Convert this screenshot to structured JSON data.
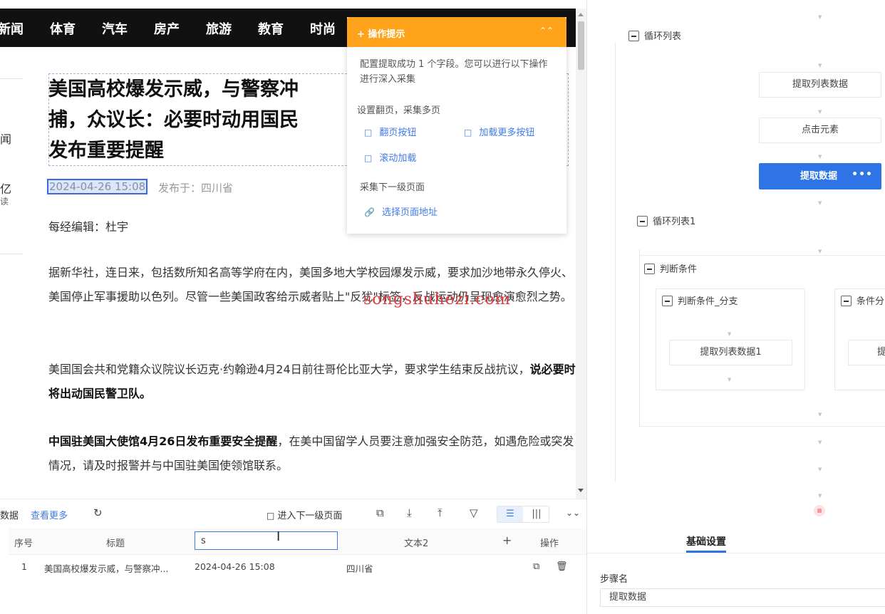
{
  "nav": {
    "items": [
      "新闻",
      "体育",
      "汽车",
      "房产",
      "旅游",
      "教育",
      "时尚"
    ]
  },
  "side_fragments": [
    "闻",
    "亿",
    "读"
  ],
  "article": {
    "title": "美国高校爆发示威，与警察冲突，逮捕，众议长：必要时动用国民警卫队 发布重要提醒",
    "title_lines": [
      "美国高校爆发示威，与警察冲",
      "捕，众议长：必要时动用国民",
      "发布重要提醒"
    ],
    "date": "2024-04-26 15:08",
    "published_from": "发布于：四川省",
    "editor": "每经编辑：杜宇",
    "para1": "据新华社，连日来，包括数所知名高等学府在内，美国多地大学校园爆发示威，要求加沙地带永久停火、美国停止军事援助以色列。尽管一些美国政客给示威者贴上\"反犹\"标签，反战运动仍呈现愈演愈烈之势。",
    "para2_normal": "美国国会共和党籍众议院议长迈克·约翰逊4月24日前往哥伦比亚大学，要求学生结束反战抗议，",
    "para2_bold": "说必要时将出动国民警卫队。",
    "para3_bold": "中国驻美国大使馆4月26日发布重要安全提醒",
    "para3_normal": "，在美中国留学人员要注意加强安全防范，如遇危险或突发情况，请及时报警并与中国驻美国使领馆联系。"
  },
  "watermark": "songshuhezi.com",
  "hint": {
    "title": "+ 操作提示",
    "collapse_icon": "chevron-up-double",
    "message": "配置提取成功 1 个字段。您可以进行以下操作进行深入采集",
    "section_paging": "设置翻页，采集多页",
    "link_page_button": "翻页按钮",
    "link_load_more": "加载更多按钮",
    "link_scroll_load": "滚动加载",
    "section_subpage": "采集下一级页面",
    "link_select_url": "选择页面地址"
  },
  "data_panel": {
    "data_label": "数据",
    "view_more": "查看更多",
    "next_level": "进入下一级页面",
    "columns": {
      "index": "序号",
      "title": "标题",
      "editing_value": "s",
      "text2": "文本2",
      "add": "+",
      "ops": "操作"
    },
    "rows": [
      {
        "index": "1",
        "title": "美国高校爆发示威，与警察冲...",
        "date": "2024-04-26 15:08",
        "text2": "四川省"
      }
    ]
  },
  "workflow": {
    "loop_list": "循环列表",
    "extract_list_data": "提取列表数据",
    "click_element": "点击元素",
    "extract_data": "提取数据",
    "more_icon": "•••",
    "loop_list_1": "循环列表1",
    "condition": "判断条件",
    "branch_1": "判断条件_分支",
    "branch_2": "条件分",
    "extract_list_data_1": "提取列表数据1",
    "branch_2_step": "提"
  },
  "settings": {
    "tab": "基础设置",
    "step_name_label": "步骤名",
    "step_name_value": "提取数据"
  },
  "colors": {
    "accent": "#2e74e6",
    "hint_orange": "#ffa31a",
    "watermark_red": "#e23a3a",
    "nav_bg": "#111111"
  }
}
